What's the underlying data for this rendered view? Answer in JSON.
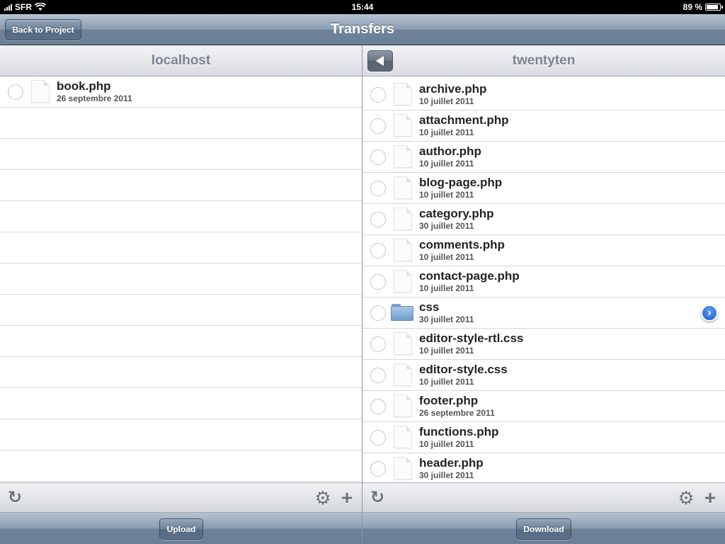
{
  "status": {
    "carrier": "SFR",
    "time": "15:44",
    "battery": "89 %",
    "battery_level": 0.89
  },
  "nav": {
    "title": "Transfers",
    "back_label": "Back to Project"
  },
  "left_pane": {
    "title": "localhost",
    "items": [
      {
        "name": "book.php",
        "date": "26 septembre 2011",
        "type": "file"
      }
    ],
    "empty_rows": 12,
    "action_label": "Upload"
  },
  "right_pane": {
    "title": "twentyten",
    "items": [
      {
        "name": "archive.php",
        "date": "10 juillet 2011",
        "type": "file"
      },
      {
        "name": "attachment.php",
        "date": "10 juillet 2011",
        "type": "file"
      },
      {
        "name": "author.php",
        "date": "10 juillet 2011",
        "type": "file"
      },
      {
        "name": "blog-page.php",
        "date": "10 juillet 2011",
        "type": "file"
      },
      {
        "name": "category.php",
        "date": "30 juillet 2011",
        "type": "file"
      },
      {
        "name": "comments.php",
        "date": "10 juillet 2011",
        "type": "file"
      },
      {
        "name": "contact-page.php",
        "date": "10 juillet 2011",
        "type": "file"
      },
      {
        "name": "css",
        "date": "30 juillet 2011",
        "type": "folder"
      },
      {
        "name": "editor-style-rtl.css",
        "date": "10 juillet 2011",
        "type": "file"
      },
      {
        "name": "editor-style.css",
        "date": "10 juillet 2011",
        "type": "file"
      },
      {
        "name": "footer.php",
        "date": "26 septembre 2011",
        "type": "file"
      },
      {
        "name": "functions.php",
        "date": "10 juillet 2011",
        "type": "file"
      },
      {
        "name": "header.php",
        "date": "30 juillet 2011",
        "type": "file"
      }
    ],
    "action_label": "Download"
  },
  "icons": {
    "refresh": "refresh-icon",
    "gear": "gear-icon",
    "plus": "plus-icon",
    "file": "file-icon",
    "folder": "folder-icon",
    "disclosure": "disclosure-arrow-icon",
    "up": "back-arrow-icon"
  },
  "colors": {
    "nav_blue": "#6e8399",
    "disclosure_blue": "#1d5fc4"
  }
}
